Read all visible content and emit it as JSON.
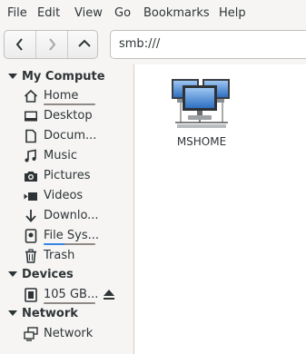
{
  "menubar": {
    "items": [
      "File",
      "Edit",
      "View",
      "Go",
      "Bookmarks",
      "Help"
    ]
  },
  "toolbar": {
    "location": "smb:///"
  },
  "sidebar": {
    "computer": {
      "title": "My Compute",
      "items": [
        {
          "label": "Home",
          "icon": "home-icon"
        },
        {
          "label": "Desktop",
          "icon": "folder-icon"
        },
        {
          "label": "Docum...",
          "icon": "document-icon"
        },
        {
          "label": "Music",
          "icon": "music-icon"
        },
        {
          "label": "Pictures",
          "icon": "camera-icon"
        },
        {
          "label": "Videos",
          "icon": "video-icon"
        },
        {
          "label": "Downlo...",
          "icon": "download-icon"
        },
        {
          "label": "File Sys...",
          "icon": "harddisk-icon"
        },
        {
          "label": "Trash",
          "icon": "trash-icon"
        }
      ]
    },
    "devices": {
      "title": "Devices",
      "items": [
        {
          "label": "105 GB...",
          "icon": "drive-icon"
        }
      ]
    },
    "network": {
      "title": "Network",
      "items": [
        {
          "label": "Network",
          "icon": "network-icon"
        }
      ]
    }
  },
  "main": {
    "items": [
      {
        "label": "MSHOME",
        "icon": "network-workgroup-icon"
      }
    ]
  }
}
